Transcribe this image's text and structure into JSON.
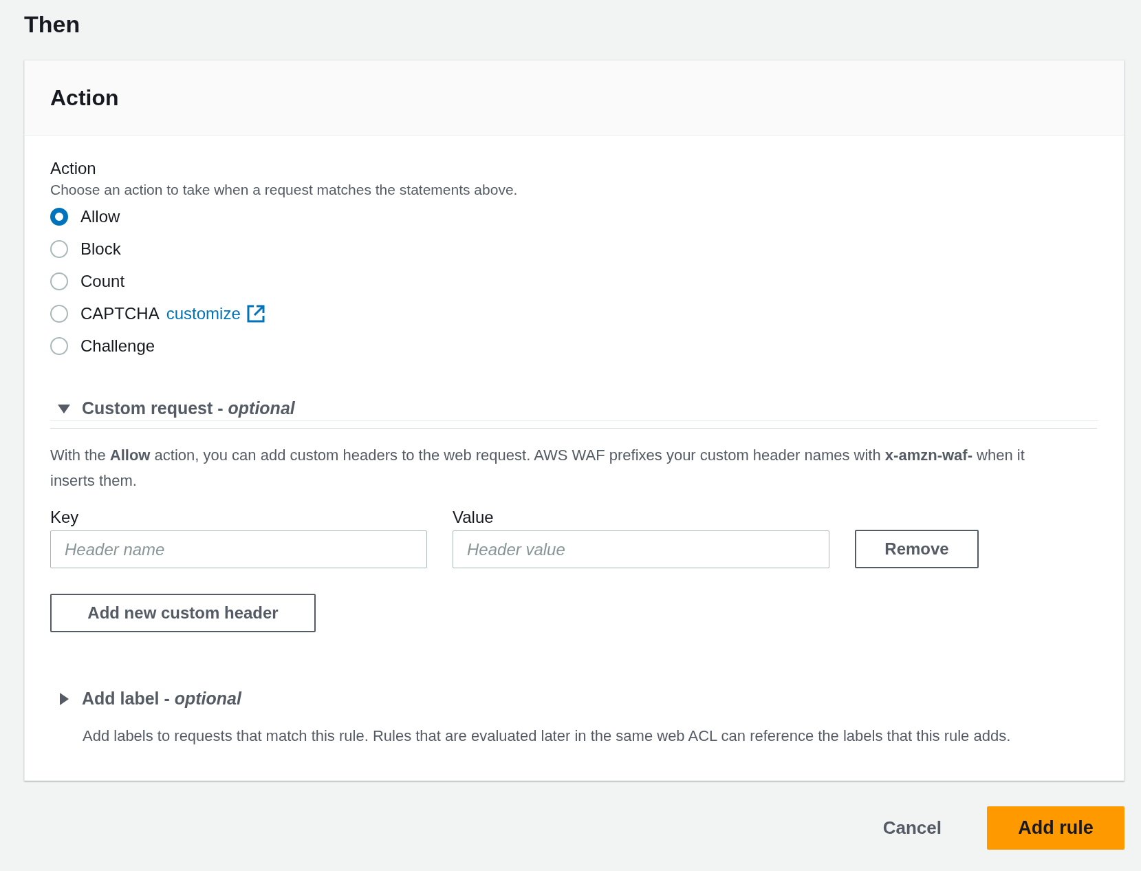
{
  "page_title": "Then",
  "panel": {
    "title": "Action",
    "action_field": {
      "label": "Action",
      "description": "Choose an action to take when a request matches the statements above.",
      "options": [
        {
          "label": "Allow",
          "selected": true
        },
        {
          "label": "Block",
          "selected": false
        },
        {
          "label": "Count",
          "selected": false
        },
        {
          "label": "CAPTCHA",
          "link": "customize",
          "selected": false
        },
        {
          "label": "Challenge",
          "selected": false
        }
      ]
    },
    "custom_request": {
      "title": "Custom request - *optional*",
      "expanded": true,
      "description": "With the **Allow** action, you can add custom headers to the web request. AWS WAF prefixes your custom header names with **x-amzn-waf-** when it inserts them.",
      "headers": [
        {
          "key_field": {
            "label": "Key",
            "placeholder": "Header name"
          },
          "value_field": {
            "label": "Value",
            "placeholder": "Header value"
          },
          "remove": "Remove"
        }
      ],
      "add_button": "Add new custom header"
    },
    "add_label": {
      "title": "Add label - *optional*",
      "expanded": false,
      "description": "Add labels to requests that match this rule. Rules that are evaluated later in the same web ACL can reference the labels that this rule adds."
    }
  },
  "footer": {
    "cancel": "Cancel",
    "submit": "Add rule"
  }
}
